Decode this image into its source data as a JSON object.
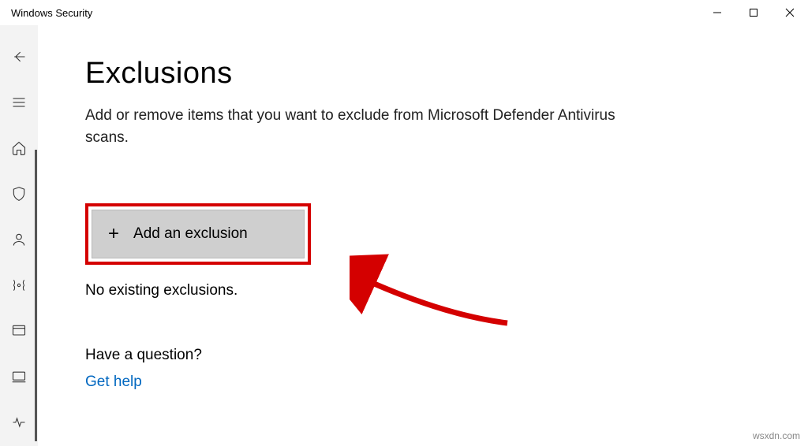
{
  "window": {
    "title": "Windows Security"
  },
  "page": {
    "heading": "Exclusions",
    "subtitle": "Add or remove items that you want to exclude from Microsoft Defender Antivirus scans.",
    "add_button_label": "Add an exclusion",
    "status_message": "No existing exclusions.",
    "question_heading": "Have a question?",
    "help_link": "Get help"
  },
  "watermark": "wsxdn.com"
}
